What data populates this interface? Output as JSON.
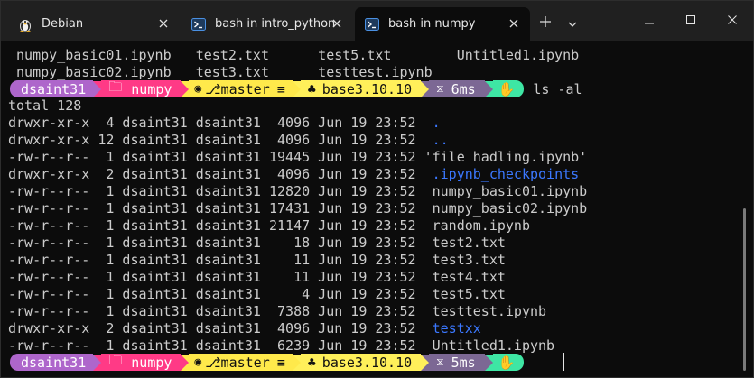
{
  "tabs": [
    {
      "title": "Debian",
      "icon": "linux-tux-icon",
      "active": false
    },
    {
      "title": "bash in intro_python",
      "icon": "terminal-icon",
      "active": false
    },
    {
      "title": "bash in numpy",
      "icon": "terminal-icon",
      "active": true
    }
  ],
  "colors": {
    "user_bg": "#ae66cb",
    "dir_bg": "#ff3a86",
    "git_bg": "#ffe94b",
    "conda_bg": "#fff05a",
    "time_bg": "#7c6894",
    "exit_bg": "#3ee6a4",
    "dir_link": "#3b78ff",
    "text": "#cccccc"
  },
  "listing_top": [
    " numpy_basic01.ipynb   test2.txt      test5.txt        Untitled1.ipynb",
    " numpy_basic02.ipynb   test3.txt      testtest.ipynb"
  ],
  "prompt1": {
    "user": "dsaint31",
    "dir": "numpy",
    "branch": "master",
    "branch_status": "≡",
    "conda": "base3.10.10",
    "time": "6ms",
    "command": "ls -al"
  },
  "ls_output": {
    "total": "total 128",
    "rows": [
      {
        "perm": "drwxr-xr-x",
        "links": "4",
        "owner": "dsaint31",
        "group": "dsaint31",
        "size": "4096",
        "date": "Jun 19 23:52",
        "name": " .",
        "dir": true
      },
      {
        "perm": "drwxr-xr-x",
        "links": "12",
        "owner": "dsaint31",
        "group": "dsaint31",
        "size": "4096",
        "date": "Jun 19 23:52",
        "name": " ..",
        "dir": true
      },
      {
        "perm": "-rw-r--r--",
        "links": "1",
        "owner": "dsaint31",
        "group": "dsaint31",
        "size": "19445",
        "date": "Jun 19 23:52",
        "name": "'file hadling.ipynb'",
        "dir": false
      },
      {
        "perm": "drwxr-xr-x",
        "links": "2",
        "owner": "dsaint31",
        "group": "dsaint31",
        "size": "4096",
        "date": "Jun 19 23:52",
        "name": " .ipynb_checkpoints",
        "dir": true
      },
      {
        "perm": "-rw-r--r--",
        "links": "1",
        "owner": "dsaint31",
        "group": "dsaint31",
        "size": "12820",
        "date": "Jun 19 23:52",
        "name": " numpy_basic01.ipynb",
        "dir": false
      },
      {
        "perm": "-rw-r--r--",
        "links": "1",
        "owner": "dsaint31",
        "group": "dsaint31",
        "size": "17431",
        "date": "Jun 19 23:52",
        "name": " numpy_basic02.ipynb",
        "dir": false
      },
      {
        "perm": "-rw-r--r--",
        "links": "1",
        "owner": "dsaint31",
        "group": "dsaint31",
        "size": "21147",
        "date": "Jun 19 23:52",
        "name": " random.ipynb",
        "dir": false
      },
      {
        "perm": "-rw-r--r--",
        "links": "1",
        "owner": "dsaint31",
        "group": "dsaint31",
        "size": "18",
        "date": "Jun 19 23:52",
        "name": " test2.txt",
        "dir": false
      },
      {
        "perm": "-rw-r--r--",
        "links": "1",
        "owner": "dsaint31",
        "group": "dsaint31",
        "size": "11",
        "date": "Jun 19 23:52",
        "name": " test3.txt",
        "dir": false
      },
      {
        "perm": "-rw-r--r--",
        "links": "1",
        "owner": "dsaint31",
        "group": "dsaint31",
        "size": "11",
        "date": "Jun 19 23:52",
        "name": " test4.txt",
        "dir": false
      },
      {
        "perm": "-rw-r--r--",
        "links": "1",
        "owner": "dsaint31",
        "group": "dsaint31",
        "size": "4",
        "date": "Jun 19 23:52",
        "name": " test5.txt",
        "dir": false
      },
      {
        "perm": "-rw-r--r--",
        "links": "1",
        "owner": "dsaint31",
        "group": "dsaint31",
        "size": "7388",
        "date": "Jun 19 23:52",
        "name": " testtest.ipynb",
        "dir": false
      },
      {
        "perm": "drwxr-xr-x",
        "links": "2",
        "owner": "dsaint31",
        "group": "dsaint31",
        "size": "4096",
        "date": "Jun 19 23:52",
        "name": " testxx",
        "dir": true
      },
      {
        "perm": "-rw-r--r--",
        "links": "1",
        "owner": "dsaint31",
        "group": "dsaint31",
        "size": "6239",
        "date": "Jun 19 23:52",
        "name": " Untitled1.ipynb",
        "dir": false
      }
    ]
  },
  "prompt2": {
    "user": "dsaint31",
    "dir": "numpy",
    "branch": "master",
    "branch_status": "≡",
    "conda": "base3.10.10",
    "time": "5ms",
    "command": ""
  }
}
